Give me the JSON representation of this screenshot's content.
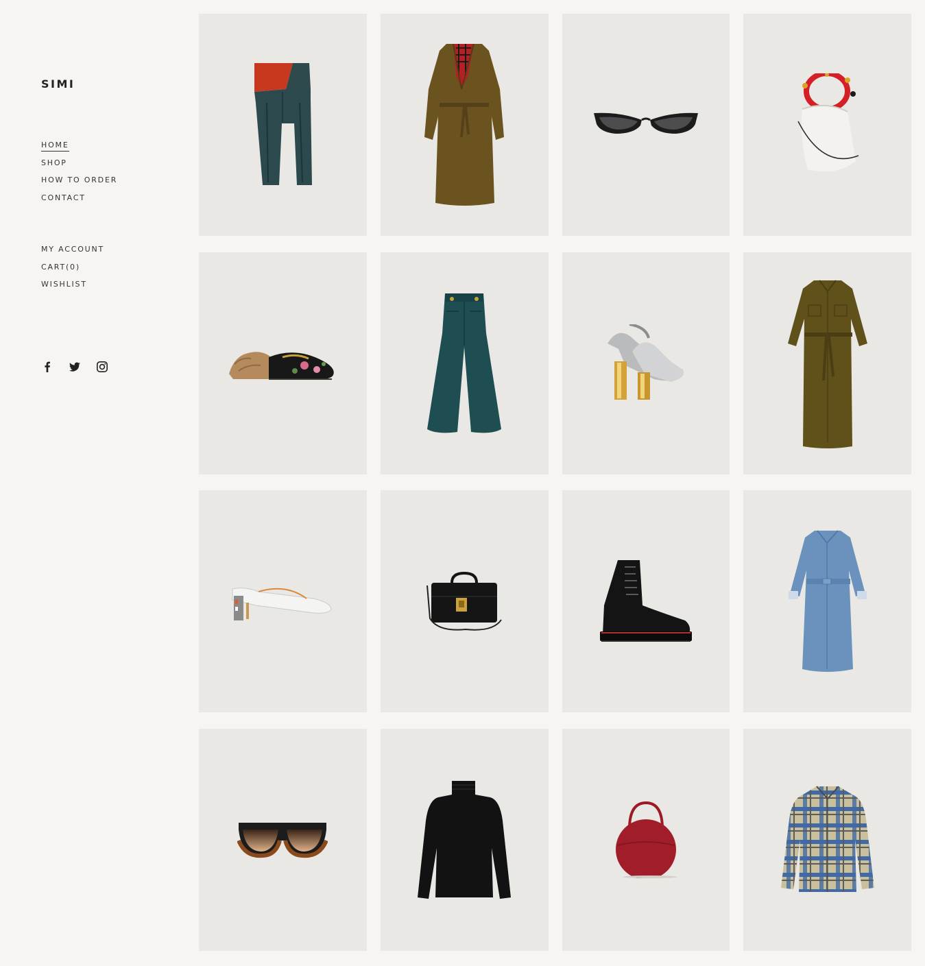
{
  "brand": "SIMI",
  "nav": {
    "main": [
      "HOME",
      "SHOP",
      "HOW TO ORDER",
      "CONTACT"
    ],
    "account": [
      "MY ACCOUNT",
      "CART(0)",
      "WISHLIST"
    ]
  },
  "social": [
    "facebook-icon",
    "twitter-icon",
    "instagram-icon"
  ],
  "products": [
    {
      "item": "leather-pants"
    },
    {
      "item": "trench-coat"
    },
    {
      "item": "cat-eye-sunglasses"
    },
    {
      "item": "bucket-bag"
    },
    {
      "item": "fur-loafer"
    },
    {
      "item": "wide-leg-trousers"
    },
    {
      "item": "silver-mary-jane-heels"
    },
    {
      "item": "utility-shirt-dress"
    },
    {
      "item": "white-mule"
    },
    {
      "item": "black-handbag"
    },
    {
      "item": "combat-boot"
    },
    {
      "item": "denim-shirt-dress"
    },
    {
      "item": "gradient-sunglasses"
    },
    {
      "item": "black-turtleneck"
    },
    {
      "item": "red-circle-bag"
    },
    {
      "item": "plaid-shirt"
    }
  ]
}
